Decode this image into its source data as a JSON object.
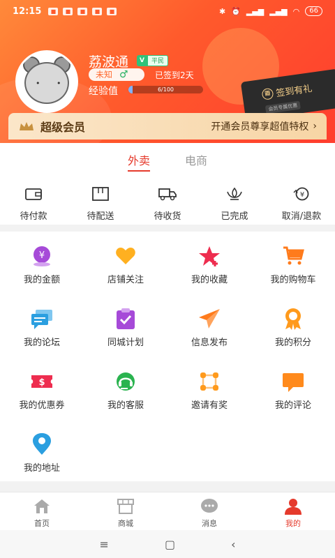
{
  "status_bar": {
    "time": "12:15",
    "battery": "66"
  },
  "profile": {
    "name": "荔波通",
    "vip_badge": "V",
    "level": "平民",
    "gender_text": "未知",
    "gender_symbol": "♂",
    "signed_days": "已签到2天",
    "exp_label": "经验值",
    "exp_text": "6/100",
    "exp_fraction": 0.06
  },
  "sign_card": {
    "title": "签到有礼",
    "subtitle": "会员专属优惠"
  },
  "vip_bar": {
    "title": "超级会员",
    "promo": "开通会员尊享超值特权",
    "chevron": "›"
  },
  "order_tabs": [
    {
      "label": "外卖",
      "active": true
    },
    {
      "label": "电商",
      "active": false
    }
  ],
  "orders": [
    {
      "label": "待付款",
      "icon": "wallet-icon"
    },
    {
      "label": "待配送",
      "icon": "box-icon"
    },
    {
      "label": "待收货",
      "icon": "truck-icon"
    },
    {
      "label": "已完成",
      "icon": "lotus-icon"
    },
    {
      "label": "取消/退款",
      "icon": "refund-icon"
    }
  ],
  "services": [
    {
      "label": "我的金额",
      "icon": "money-icon",
      "color": "#a64ad8"
    },
    {
      "label": "店铺关注",
      "icon": "heart-icon",
      "color": "#ffb020"
    },
    {
      "label": "我的收藏",
      "icon": "star-icon",
      "color": "#ee2d4f"
    },
    {
      "label": "我的购物车",
      "icon": "cart-icon",
      "color": "#ff7b1c"
    },
    {
      "label": "我的论坛",
      "icon": "forum-icon",
      "color": "#2b9fe0"
    },
    {
      "label": "同城计划",
      "icon": "clipboard-icon",
      "color": "#a64ad8"
    },
    {
      "label": "信息发布",
      "icon": "paper-plane-icon",
      "color": "#ff7b1c"
    },
    {
      "label": "我的积分",
      "icon": "medal-icon",
      "color": "#ff9a1c"
    },
    {
      "label": "我的优惠券",
      "icon": "coupon-icon",
      "color": "#ee2d4f"
    },
    {
      "label": "我的客服",
      "icon": "headset-icon",
      "color": "#2ab34f"
    },
    {
      "label": "邀请有奖",
      "icon": "network-icon",
      "color": "#ff9a1c"
    },
    {
      "label": "我的评论",
      "icon": "comment-icon",
      "color": "#ff8a1c"
    },
    {
      "label": "我的地址",
      "icon": "location-icon",
      "color": "#2b9fe0"
    }
  ],
  "bottom_nav": [
    {
      "label": "首页",
      "icon": "home-icon",
      "active": false
    },
    {
      "label": "商城",
      "icon": "store-icon",
      "active": false
    },
    {
      "label": "消息",
      "icon": "chat-icon",
      "active": false
    },
    {
      "label": "我的",
      "icon": "user-icon",
      "active": true
    }
  ],
  "system_nav": {
    "menu": "≡",
    "home": "▢",
    "back": "‹"
  }
}
